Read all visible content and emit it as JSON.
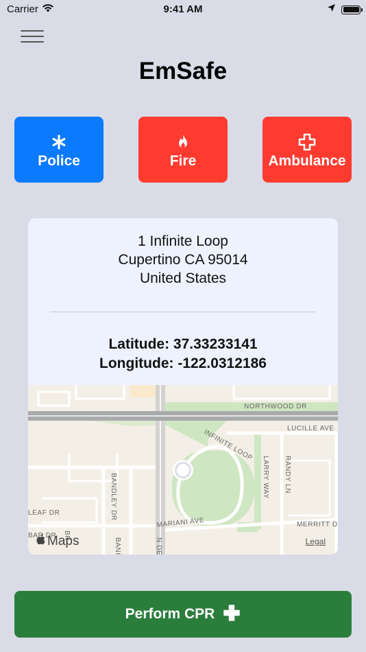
{
  "status_bar": {
    "carrier": "Carrier",
    "time": "9:41 AM"
  },
  "app": {
    "title": "EmSafe"
  },
  "emergency_buttons": [
    {
      "label": "Police",
      "icon": "asterisk-icon",
      "color": "#0a7aff"
    },
    {
      "label": "Fire",
      "icon": "flame-icon",
      "color": "#ff3b30"
    },
    {
      "label": "Ambulance",
      "icon": "medical-cross-icon",
      "color": "#ff3b30"
    }
  ],
  "location": {
    "address_line1": "1 Infinite Loop",
    "address_line2": "Cupertino CA 95014",
    "address_line3": "United States",
    "latitude_text": "Latitude:  37.33233141",
    "longitude_text": "Longitude:  -122.0312186"
  },
  "map": {
    "streets": [
      "NORTHWOOD DR",
      "LUCILLE AVE",
      "INFINITE LOOP",
      "LARRY WAY",
      "RANDY LN",
      "BANDLEY DR",
      "LEAF DR",
      "MARIANI AVE",
      "MERRITT DR",
      "N DE",
      "BANG",
      "BAR DR",
      "BR"
    ],
    "attribution": "Maps",
    "legal": "Legal"
  },
  "cpr": {
    "label": "Perform CPR"
  },
  "colors": {
    "background": "#d9dbe6",
    "police": "#0a7aff",
    "fire": "#ff3b30",
    "cpr": "#2b7d3c"
  }
}
